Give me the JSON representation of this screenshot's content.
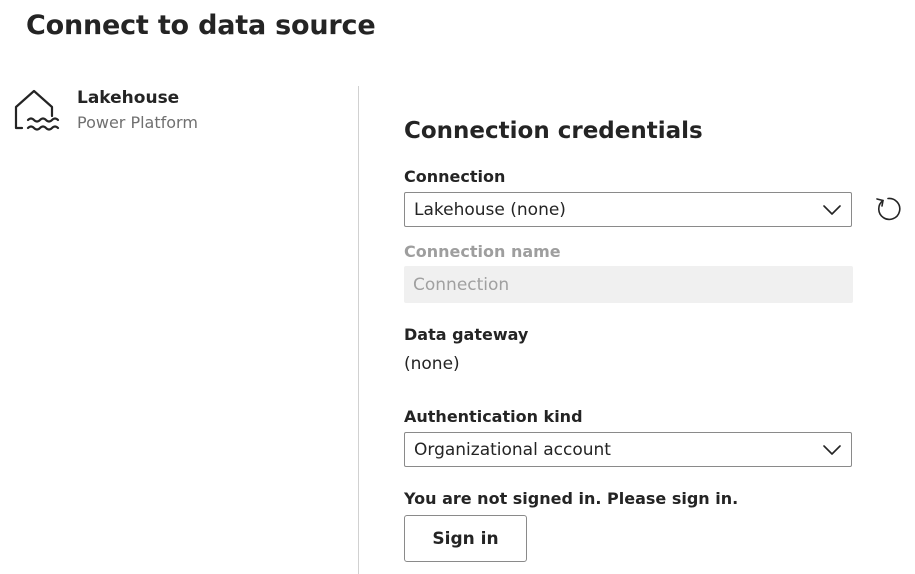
{
  "page": {
    "title": "Connect to data source"
  },
  "source": {
    "name": "Lakehouse",
    "category": "Power Platform",
    "icon": "lakehouse-icon"
  },
  "credentials": {
    "title": "Connection credentials",
    "connection": {
      "label": "Connection",
      "value": "Lakehouse (none)"
    },
    "connection_name": {
      "label": "Connection name",
      "placeholder": "Connection"
    },
    "data_gateway": {
      "label": "Data gateway",
      "value": "(none)"
    },
    "authentication_kind": {
      "label": "Authentication kind",
      "value": "Organizational account"
    },
    "signin_message": "You are not signed in. Please sign in.",
    "signin_button": "Sign in"
  },
  "colors": {
    "text": "#242424",
    "muted": "#707070",
    "disabled_text": "#9e9e9e",
    "disabled_fill": "#f0f0f0",
    "border": "#8a8a8a",
    "divider": "#d1d1d1"
  }
}
